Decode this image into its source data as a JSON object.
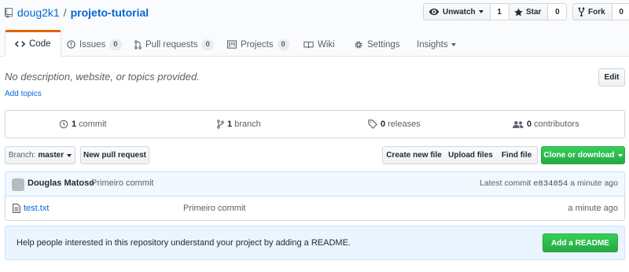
{
  "repo": {
    "owner": "doug2k1",
    "separator": "/",
    "name": "projeto-tutorial"
  },
  "actions": {
    "watch": {
      "label": "Unwatch",
      "count": "1"
    },
    "star": {
      "label": "Star",
      "count": "0"
    },
    "fork": {
      "label": "Fork",
      "count": "0"
    }
  },
  "tabs": [
    {
      "label": "Code",
      "count": null,
      "selected": true
    },
    {
      "label": "Issues",
      "count": "0"
    },
    {
      "label": "Pull requests",
      "count": "0"
    },
    {
      "label": "Projects",
      "count": "0"
    },
    {
      "label": "Wiki",
      "count": null
    },
    {
      "label": "Settings",
      "count": null
    },
    {
      "label": "Insights",
      "count": null
    }
  ],
  "about": {
    "description": "No description, website, or topics provided.",
    "add_topics": "Add topics",
    "edit": "Edit"
  },
  "summary": [
    {
      "value": "1",
      "label": "commit"
    },
    {
      "value": "1",
      "label": "branch"
    },
    {
      "value": "0",
      "label": "releases"
    },
    {
      "value": "0",
      "label": "contributors"
    }
  ],
  "toolbar": {
    "branch_prefix": "Branch:",
    "branch": "master",
    "new_pr": "New pull request",
    "create_file": "Create new file",
    "upload": "Upload files",
    "find": "Find file",
    "clone": "Clone or download"
  },
  "latest_commit": {
    "author": "Douglas Matoso",
    "message": "Primeiro commit",
    "prefix": "Latest commit",
    "sha": "e834854",
    "age": "a minute ago"
  },
  "files": [
    {
      "name": "test.txt",
      "message": "Primeiro commit",
      "age": "a minute ago"
    }
  ],
  "readme": {
    "prompt": "Help people interested in this repository understand your project by adding a README.",
    "button": "Add a README"
  },
  "colors": {
    "link": "#0366d6",
    "tab_accent": "#e36209",
    "green": "#28a745"
  }
}
